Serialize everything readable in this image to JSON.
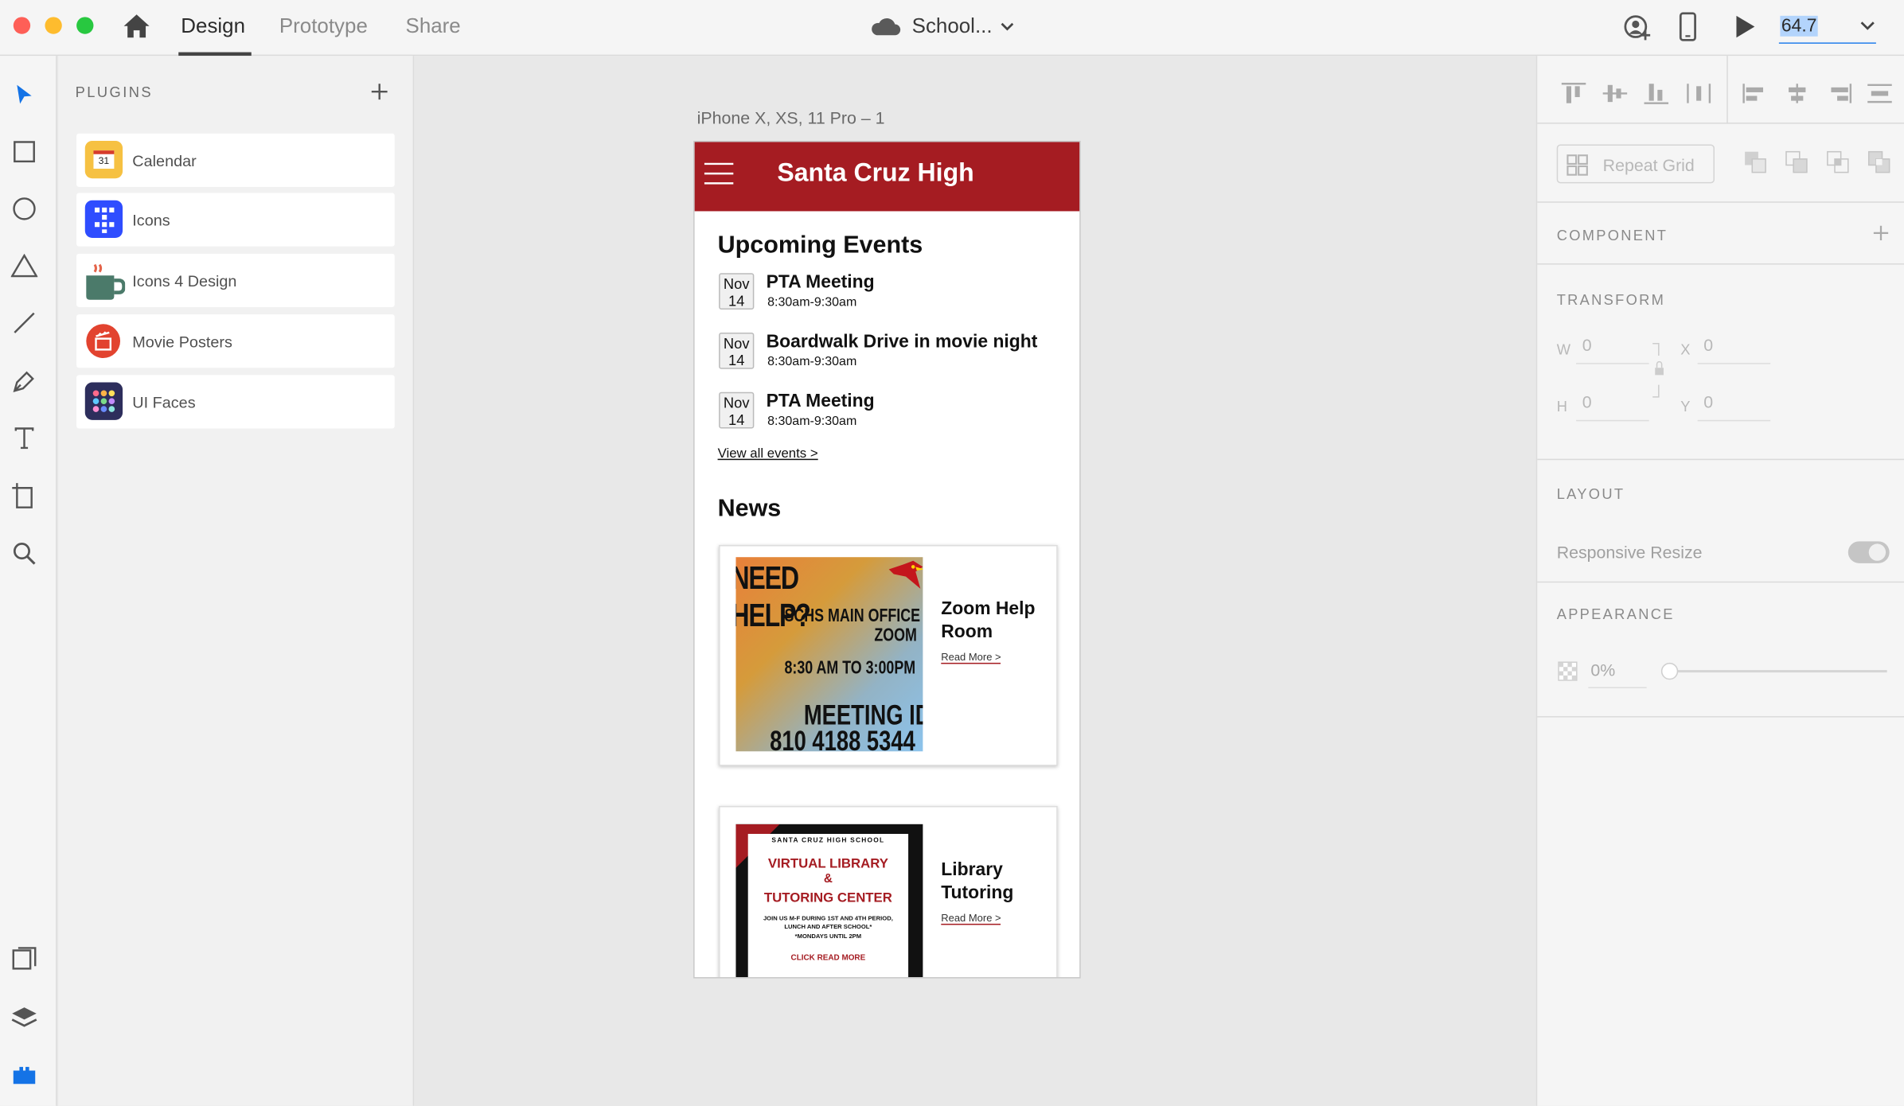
{
  "window": {
    "tabs": [
      "Design",
      "Prototype",
      "Share"
    ],
    "active_tab": "Design",
    "doc_title": "School...",
    "zoom": "64.7"
  },
  "plugins_panel": {
    "title": "PLUGINS",
    "items": [
      {
        "label": "Calendar",
        "icon": "calendar-icon",
        "day": "31"
      },
      {
        "label": "Icons",
        "icon": "icons-grid-icon"
      },
      {
        "label": "Icons 4 Design",
        "icon": "coffee-cup-icon"
      },
      {
        "label": "Movie Posters",
        "icon": "clapperboard-icon"
      },
      {
        "label": "UI Faces",
        "icon": "dots-grid-icon"
      }
    ]
  },
  "artboard": {
    "name": "iPhone X, XS, 11 Pro – 1"
  },
  "app": {
    "header_title": "Santa Cruz High",
    "events_heading": "Upcoming Events",
    "events": [
      {
        "month": "Nov",
        "day": "14",
        "title": "PTA Meeting",
        "time": "8:30am-9:30am"
      },
      {
        "month": "Nov",
        "day": "14",
        "title": "Boardwalk Drive in movie night",
        "time": "8:30am-9:30am"
      },
      {
        "month": "Nov",
        "day": "14",
        "title": "PTA Meeting",
        "time": "8:30am-9:30am"
      }
    ],
    "view_all": "View all events >",
    "news_heading": "News",
    "news": [
      {
        "title_line1": "Zoom Help",
        "title_line2": "Room",
        "read_more": "Read More >",
        "poster": {
          "line1": "NEED HELP?",
          "line2": "SCHS MAIN OFFICE",
          "line3": "ZOOM",
          "line4": "8:30 AM TO 3:00PM",
          "line5": "MEETING ID:",
          "line6": "810 4188 5344"
        }
      },
      {
        "title_line1": "Library",
        "title_line2": "Tutoring",
        "read_more": "Read More >",
        "poster": {
          "line1": "SANTA CRUZ HIGH SCHOOL",
          "line2": "VIRTUAL LIBRARY",
          "line3": "&",
          "line4": "TUTORING CENTER",
          "line5": "JOIN US M-F DURING 1ST AND 4TH PERIOD, LUNCH AND AFTER SCHOOL*",
          "line6": "*MONDAYS UNTIL 2PM",
          "line7": "CLICK READ MORE"
        }
      }
    ]
  },
  "properties": {
    "repeat_grid": "Repeat Grid",
    "component": "COMPONENT",
    "transform": "TRANSFORM",
    "w_label": "W",
    "w_value": "0",
    "x_label": "X",
    "x_value": "0",
    "h_label": "H",
    "h_value": "0",
    "y_label": "Y",
    "y_value": "0",
    "layout": "LAYOUT",
    "responsive_resize": "Responsive Resize",
    "appearance": "APPEARANCE",
    "opacity": "0%"
  },
  "colors": {
    "brand_red": "#a51c22",
    "accent_blue": "#2680eb"
  }
}
